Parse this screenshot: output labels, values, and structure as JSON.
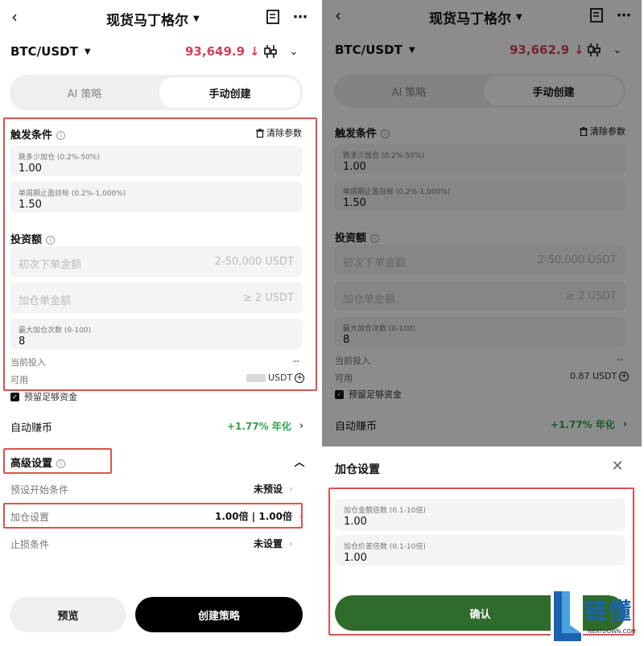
{
  "header": {
    "title": "现货马丁格尔"
  },
  "pair": {
    "name": "BTC/USDT"
  },
  "left_price": "93,649.9",
  "right_price": "93,662.9",
  "tabs": {
    "ai": "AI 策略",
    "manual": "手动创建"
  },
  "trigger": {
    "title": "触发条件",
    "clear": "清除参数",
    "drop_label": "跌多少加仓 (0.2%-50%)",
    "drop_value": "1.00",
    "tp_label": "单周期止盈目标 (0.2%-1,000%)",
    "tp_value": "1.50"
  },
  "invest": {
    "title": "投资额",
    "first_ph": "初次下单金额",
    "first_hint": "2-50,000 USDT",
    "add_ph": "加仓单金额",
    "add_hint": "≥ 2 USDT",
    "max_label": "最大加仓次数 (0-100)",
    "max_value": "8",
    "current_label": "当前投入",
    "current_value": "--",
    "avail_label": "可用",
    "avail_value_left": "USDT",
    "avail_value_right": "0.87 USDT",
    "reserve": "预留足够资金"
  },
  "auto": {
    "label": "自动赚币",
    "value": "+1.77% 年化"
  },
  "advanced": {
    "title": "高级设置",
    "preset_label": "预设开始条件",
    "preset_value": "未预设",
    "addset_label": "加仓设置",
    "addset_value": "1.00倍 | 1.00倍",
    "stop_label": "止损条件",
    "stop_value": "未设置"
  },
  "buttons": {
    "preview": "预览",
    "create": "创建策略"
  },
  "sheet": {
    "title": "加仓设置",
    "mult_label": "加仓金额倍数 (0.1-10倍)",
    "mult_value": "1.00",
    "spread_label": "加仓价差倍数 (0.1-10倍)",
    "spread_value": "1.00",
    "confirm": "确认"
  },
  "watermark": {
    "text": "链懂",
    "sub": "NEATDOWN.COM"
  }
}
